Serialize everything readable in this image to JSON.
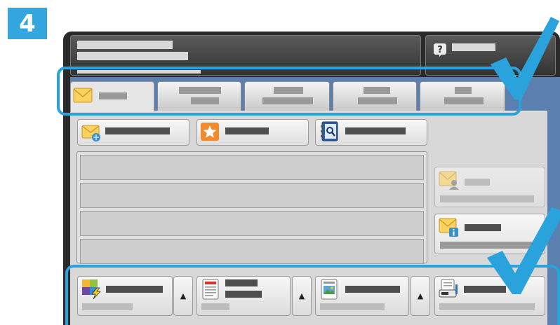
{
  "step_number": "4",
  "colors": {
    "highlight": "#2aa3dd",
    "check": "#2aa3dd",
    "badge": "#33a6df",
    "screen_bg": "#5b7fae"
  },
  "tabs": [
    {
      "icon": "envelope-icon",
      "active": true
    },
    {
      "active": false
    },
    {
      "active": false
    },
    {
      "active": false
    },
    {
      "active": false
    }
  ],
  "actions": [
    {
      "icon": "envelope-add-icon"
    },
    {
      "icon": "star-icon"
    },
    {
      "icon": "address-book-icon"
    }
  ],
  "side_buttons": [
    {
      "icon": "envelope-person-icon",
      "disabled": true
    },
    {
      "icon": "envelope-info-icon",
      "disabled": false
    }
  ],
  "features": [
    {
      "icon": "color-mode-icon",
      "has_arrow": true
    },
    {
      "icon": "document-icon",
      "has_arrow": true
    },
    {
      "icon": "image-icon",
      "has_arrow": true
    },
    {
      "icon": "scanner-icon",
      "has_arrow": false
    }
  ],
  "arrow_glyph": "▲",
  "help_glyph": "?"
}
